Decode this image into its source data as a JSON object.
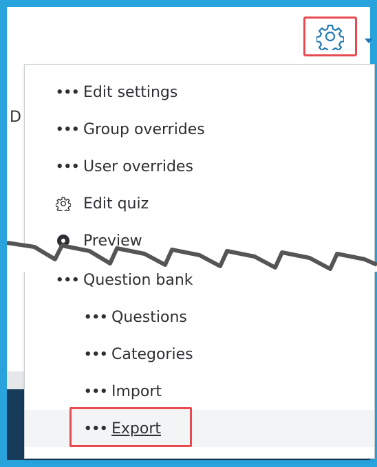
{
  "header": {
    "gear_icon": "gear-icon"
  },
  "side_text": "D",
  "menu": {
    "items": [
      {
        "label": "Edit settings",
        "icon": "more-dots-icon"
      },
      {
        "label": "Group overrides",
        "icon": "more-dots-icon"
      },
      {
        "label": "User overrides",
        "icon": "more-dots-icon"
      },
      {
        "label": "Edit quiz",
        "icon": "gear-icon"
      },
      {
        "label": "Preview",
        "icon": "preview-icon"
      },
      {
        "label": "Question bank",
        "icon": "more-dots-icon"
      },
      {
        "label": "Questions",
        "icon": "more-dots-icon"
      },
      {
        "label": "Categories",
        "icon": "more-dots-icon"
      },
      {
        "label": "Import",
        "icon": "more-dots-icon"
      },
      {
        "label": "Export",
        "icon": "more-dots-icon"
      }
    ],
    "dots": "•••"
  },
  "colors": {
    "frame": "#29a3dc",
    "highlight": "#e84a4f",
    "accent": "#1f78b4"
  }
}
